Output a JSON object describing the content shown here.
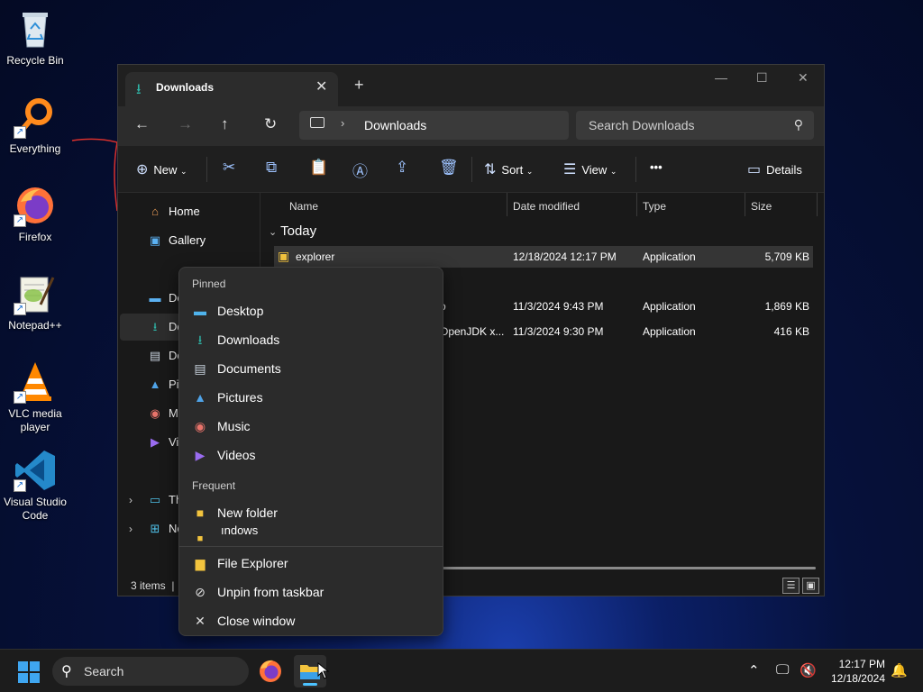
{
  "desktop": {
    "icons": [
      {
        "label": "Recycle Bin",
        "icon": "recycle-bin-icon"
      },
      {
        "label": "Everything",
        "icon": "everything-search-icon"
      },
      {
        "label": "Firefox",
        "icon": "firefox-icon"
      },
      {
        "label": "Notepad++",
        "icon": "notepad-plus-plus-icon"
      },
      {
        "label": "VLC media player",
        "icon": "vlc-icon"
      },
      {
        "label": "Visual Studio Code",
        "icon": "vscode-icon"
      }
    ]
  },
  "window": {
    "tab_title": "Downloads",
    "breadcrumb": "Downloads",
    "search_placeholder": "Search Downloads",
    "toolbar": {
      "new_label": "New",
      "sort_label": "Sort",
      "view_label": "View",
      "more_label": "•••",
      "details_label": "Details"
    },
    "sidebar": {
      "home": "Home",
      "gallery": "Gallery",
      "desktop": "De",
      "downloads": "Do",
      "documents": "Do",
      "pictures": "Pi",
      "music": "M",
      "videos": "Vi",
      "this_pc": "Th",
      "network": "Ne"
    },
    "columns": {
      "name": "Name",
      "date": "Date modified",
      "type": "Type",
      "size": "Size"
    },
    "group_today": "Today",
    "files": [
      {
        "name": "explorer",
        "date": "12/18/2024 12:17 PM",
        "type": "Application",
        "size": "5,709 KB"
      },
      {
        "name": "o",
        "date": "11/3/2024 9:43 PM",
        "type": "Application",
        "size": "1,869 KB"
      },
      {
        "name": "OpenJDK x...",
        "date": "11/3/2024 9:30 PM",
        "type": "Application",
        "size": "416 KB"
      }
    ],
    "status_items": "3 items",
    "status_sep": "|"
  },
  "jumplist": {
    "pinned_header": "Pinned",
    "pinned": [
      {
        "label": "Desktop",
        "icon": "desktop-folder-icon"
      },
      {
        "label": "Downloads",
        "icon": "download-icon"
      },
      {
        "label": "Documents",
        "icon": "document-icon"
      },
      {
        "label": "Pictures",
        "icon": "pictures-icon"
      },
      {
        "label": "Music",
        "icon": "music-icon"
      },
      {
        "label": "Videos",
        "icon": "videos-icon"
      }
    ],
    "frequent_header": "Frequent",
    "frequent": [
      {
        "label": "New folder",
        "icon": "folder-icon"
      },
      {
        "label": "ındows",
        "icon": "folder-icon"
      }
    ],
    "actions": [
      {
        "label": "File Explorer",
        "icon": "file-explorer-icon"
      },
      {
        "label": "Unpin from taskbar",
        "icon": "unpin-icon"
      },
      {
        "label": "Close window",
        "icon": "close-icon"
      }
    ]
  },
  "taskbar": {
    "search_label": "Search",
    "time": "12:17 PM",
    "date": "12/18/2024"
  }
}
